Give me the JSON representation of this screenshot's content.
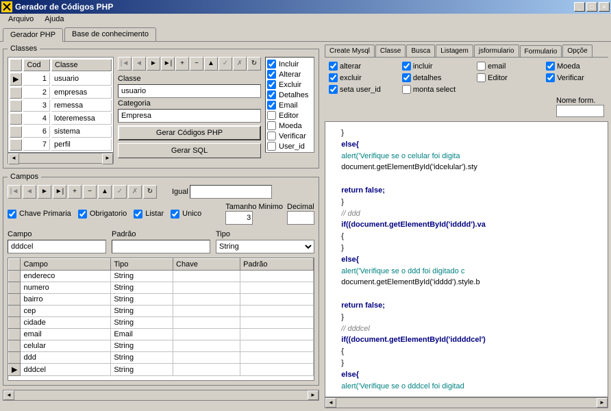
{
  "window": {
    "title": "Gerador de Códigos PHP"
  },
  "menu": {
    "arquivo": "Arquivo",
    "ajuda": "Ajuda"
  },
  "tabs": {
    "main": [
      "Gerador PHP",
      "Base de conhecimento"
    ]
  },
  "classes": {
    "legend": "Classes",
    "cols": [
      "Cod",
      "Classe"
    ],
    "rows": [
      {
        "cod": "1",
        "classe": "usuario"
      },
      {
        "cod": "2",
        "classe": "empresas"
      },
      {
        "cod": "3",
        "classe": "remessa"
      },
      {
        "cod": "4",
        "classe": "loteremessa"
      },
      {
        "cod": "6",
        "classe": "sistema"
      },
      {
        "cod": "7",
        "classe": "perfil"
      }
    ],
    "classe_label": "Classe",
    "classe_value": "usuario",
    "categoria_label": "Categoria",
    "categoria_value": "Empresa",
    "btn_gerar_php": "Gerar Códigos PHP",
    "btn_gerar_sql": "Gerar SQL",
    "opts": [
      {
        "label": "Incluir",
        "chk": true
      },
      {
        "label": "Alterar",
        "chk": true
      },
      {
        "label": "Excluir",
        "chk": true
      },
      {
        "label": "Detalhes",
        "chk": true
      },
      {
        "label": "Email",
        "chk": true
      },
      {
        "label": "Editor",
        "chk": false
      },
      {
        "label": "Moeda",
        "chk": false
      },
      {
        "label": "Verificar",
        "chk": false
      },
      {
        "label": "User_id",
        "chk": false
      }
    ]
  },
  "campos": {
    "legend": "Campos",
    "igual_label": "Igual",
    "igual_value": "",
    "chks": [
      {
        "label": "Chave Primaria",
        "chk": true
      },
      {
        "label": "Obrigatorio",
        "chk": true
      },
      {
        "label": "Listar",
        "chk": true
      },
      {
        "label": "Unico",
        "chk": true
      }
    ],
    "tamanho_label": "Tamanho Minimo",
    "tamanho_value": "3",
    "decimal_label": "Decimal",
    "decimal_value": "",
    "campo_label": "Campo",
    "campo_value": "dddcel",
    "padrao_label": "Padrão",
    "padrao_value": "",
    "tipo_label": "Tipo",
    "tipo_value": "String",
    "grid_cols": [
      "Campo",
      "Tipo",
      "Chave",
      "Padrão"
    ],
    "grid_rows": [
      {
        "campo": "endereco",
        "tipo": "String",
        "chave": "",
        "padrao": ""
      },
      {
        "campo": "numero",
        "tipo": "String",
        "chave": "",
        "padrao": ""
      },
      {
        "campo": "bairro",
        "tipo": "String",
        "chave": "",
        "padrao": ""
      },
      {
        "campo": "cep",
        "tipo": "String",
        "chave": "",
        "padrao": ""
      },
      {
        "campo": "cidade",
        "tipo": "String",
        "chave": "",
        "padrao": ""
      },
      {
        "campo": "email",
        "tipo": "Email",
        "chave": "",
        "padrao": ""
      },
      {
        "campo": "celular",
        "tipo": "String",
        "chave": "",
        "padrao": ""
      },
      {
        "campo": "ddd",
        "tipo": "String",
        "chave": "",
        "padrao": ""
      },
      {
        "campo": "dddcel",
        "tipo": "String",
        "chave": "",
        "padrao": ""
      }
    ]
  },
  "right": {
    "tabs": [
      "Create Mysql",
      "Classe",
      "Busca",
      "Listagem",
      "jsformulario",
      "Formulario",
      "Opçõe"
    ],
    "active_tab": "Formulario",
    "nome_form_label": "Nome form.",
    "opts": [
      {
        "label": "alterar",
        "chk": true
      },
      {
        "label": "incluir",
        "chk": true
      },
      {
        "label": "email",
        "chk": false
      },
      {
        "label": "Moeda",
        "chk": true
      },
      {
        "label": "excluir",
        "chk": true
      },
      {
        "label": "detalhes",
        "chk": true
      },
      {
        "label": "Editor",
        "chk": false
      },
      {
        "label": "Verificar",
        "chk": true
      },
      {
        "label": "seta user_id",
        "chk": true
      },
      {
        "label": "monta select",
        "chk": false
      }
    ],
    "code_lines": [
      {
        "t": "     }",
        "cls": ""
      },
      {
        "t": "     else{",
        "cls": "kw"
      },
      {
        "t": "     alert('Verifique se o celular foi digita",
        "cls": "str"
      },
      {
        "t": "     document.getElementById('idcelular').sty",
        "cls": ""
      },
      {
        "t": "",
        "cls": ""
      },
      {
        "t": "     return false;",
        "cls": "kw"
      },
      {
        "t": "     }",
        "cls": ""
      },
      {
        "t": "     // ddd",
        "cls": "cmt"
      },
      {
        "t": "     if((document.getElementById('idddd').va",
        "cls": "kw"
      },
      {
        "t": "     {",
        "cls": ""
      },
      {
        "t": "     }",
        "cls": ""
      },
      {
        "t": "     else{",
        "cls": "kw"
      },
      {
        "t": "     alert('Verifique se o ddd foi digitado c",
        "cls": "str"
      },
      {
        "t": "     document.getElementById('idddd').style.b",
        "cls": ""
      },
      {
        "t": "",
        "cls": ""
      },
      {
        "t": "     return false;",
        "cls": "kw"
      },
      {
        "t": "     }",
        "cls": ""
      },
      {
        "t": "     // dddcel",
        "cls": "cmt"
      },
      {
        "t": "     if((document.getElementById('iddddcel')",
        "cls": "kw"
      },
      {
        "t": "     {",
        "cls": ""
      },
      {
        "t": "     }",
        "cls": ""
      },
      {
        "t": "     else{",
        "cls": "kw"
      },
      {
        "t": "     alert('Verifique se o dddcel foi digitad",
        "cls": "str"
      }
    ]
  }
}
